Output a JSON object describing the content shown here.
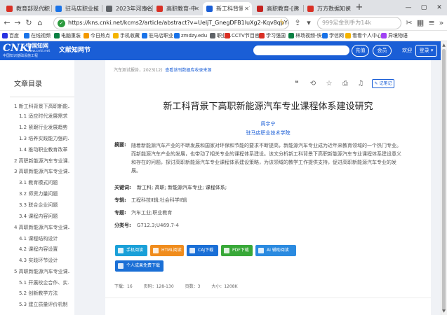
{
  "browser": {
    "tabs": [
      {
        "label": "教育部现代职",
        "color": "#d93025"
      },
      {
        "label": "驻马店职业技",
        "color": "#1a73e8"
      },
      {
        "label": "2023年河南省",
        "color": "#5f6368"
      },
      {
        "label": "高职教育-中",
        "color": "#d93025"
      },
      {
        "label": "新工科背景下",
        "color": "#1a5ed6",
        "active": true
      },
      {
        "label": "高职教育-[资",
        "color": "#c5221f"
      },
      {
        "label": "万方数据知识",
        "color": "#d93025"
      }
    ],
    "new_tab": "+",
    "window_controls": [
      "—",
      "▢",
      "✕"
    ],
    "url": "https://kns.cnki.net/kcms2/article/abstract?v=UeljT_GnegDFB1luXg2-Kqv8qpYHQtUhxCP",
    "search_placeholder": "999足金到手为14k",
    "bookmarks": [
      {
        "label": "百度",
        "color": "#2932e1"
      },
      {
        "label": "在线视频",
        "color": "#1a73e8"
      },
      {
        "label": "电脑重装",
        "color": "#0b8043"
      },
      {
        "label": "今日热点",
        "color": "#f29900"
      },
      {
        "label": "手机收藏",
        "color": "#f4b400"
      },
      {
        "label": "驻马店职业",
        "color": "#1a73e8"
      },
      {
        "label": "zmdzy.edu",
        "color": "#1a73e8"
      },
      {
        "label": "职业...",
        "color": "#5f6368"
      },
      {
        "label": "CCTV节目官",
        "color": "#d93025"
      },
      {
        "label": "学习强国",
        "color": "#d93025"
      },
      {
        "label": "林场视频-快",
        "color": "#0b8043"
      },
      {
        "label": "学信网",
        "color": "#1a73e8"
      },
      {
        "label": "看看个人中心",
        "color": "#f4b400"
      },
      {
        "label": "异境物语",
        "color": "#a142f4"
      }
    ]
  },
  "header": {
    "logo_text": "CNKi",
    "logo_cn": "中国知网",
    "logo_url": "www.cnki.net",
    "logo_sub": "中国知识基础设施工程",
    "site_title": "文献知网节",
    "btn_recharge": "充值",
    "btn_member": "会员",
    "welcome": "欢迎",
    "login": "登录"
  },
  "toc": {
    "title": "文章目录",
    "items": [
      "1 新工科背景下高职新能...",
      "1.1 适应时代发展需求",
      "1.2 紧跟行业发展趋势",
      "1.3 培养实践能力强的...",
      "1.4 推动职业教育改革",
      "2 高职新能源汽车专业课...",
      "3 高职新能源汽车专业课...",
      "3.1 教育模式问题",
      "3.2 师资力量问题",
      "3.3 联合企业问题",
      "3.4 课程内容问题",
      "4 高职新能源汽车专业课...",
      "4.1 课程结构设计",
      "4.2 课程内容设置",
      "4.3 实践环节设计",
      "5 高职新能源汽车专业课...",
      "5.1 开展校企合作、实...",
      "5.2 创新教学方法",
      "5.3 建立质量评价机制"
    ]
  },
  "article": {
    "journal_line": "汽车测试报告，2023(12)",
    "journal_link": "查看该刊数据库收录来源",
    "recnote_label": "记笔记",
    "title": "新工科背景下高职新能源汽车专业课程体系建设研究",
    "author": "周宇宁",
    "org": "驻马店职业技术学院",
    "abstract_label": "摘要:",
    "abstract": "随着新能源汽车产业的不断发展和国家对环保和节能的要求不断提高，新能源汽车专业成为近年来教育领域的一个热门专业。而新能源汽车产业的发展，也带动了相关专业的课程体系建设。该文分析新工科背景下高职新能源汽车专业课程体系建设意义和存在的问题，探讨高职新能源汽车专业课程体系建设策略，为该领域的教学工作提供支持，促进高职新能源汽车专业的发展。",
    "keywords_label": "关键词:",
    "keywords": "新工科;  高职;  新能源汽车专业;  课程体系;",
    "series_label": "专辑:",
    "series": "工程科技Ⅱ辑;社会科学Ⅱ辑",
    "topic_label": "专题:",
    "topic": "汽车工业;职业教育",
    "class_label": "分类号:",
    "class": "G712.3;U469.7-4",
    "buttons": [
      {
        "label": "手机阅读",
        "color": "#1aa0d8"
      },
      {
        "label": "HTML阅读",
        "color": "#f08c1c"
      },
      {
        "label": "CAJ下载",
        "color": "#1a6fd6"
      },
      {
        "label": "PDF下载",
        "color": "#38a838"
      },
      {
        "label": "AI 辅助阅读",
        "color": "#2a8ae0"
      },
      {
        "label": "个人成果免费下载",
        "color": "#1a6fd6"
      }
    ],
    "stats": {
      "downloads": "下载：16",
      "pages": "页码：128-130",
      "page_count": "页数：3",
      "size": "大小：1208K"
    }
  }
}
